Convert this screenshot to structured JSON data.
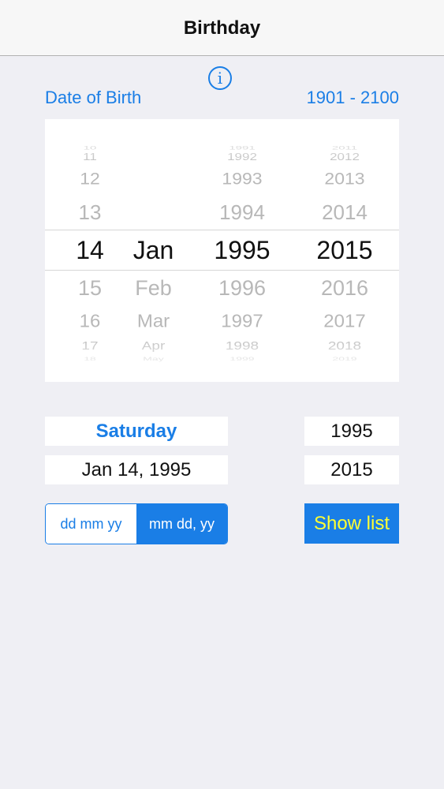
{
  "navbar": {
    "title": "Birthday"
  },
  "info": {
    "glyph": "i"
  },
  "header": {
    "dob_label": "Date of Birth",
    "range_label": "1901 - 2100"
  },
  "picker": {
    "days": [
      "10",
      "11",
      "12",
      "13",
      "14",
      "15",
      "16",
      "17",
      "18"
    ],
    "months": [
      "",
      "",
      "",
      "",
      "Jan",
      "Feb",
      "Mar",
      "Apr",
      "May"
    ],
    "years1": [
      "1991",
      "1992",
      "1993",
      "1994",
      "1995",
      "1996",
      "1997",
      "1998",
      "1999"
    ],
    "years2": [
      "2011",
      "2012",
      "2013",
      "2014",
      "2015",
      "2016",
      "2017",
      "2018",
      "2019"
    ],
    "selected_index": 4
  },
  "result": {
    "weekday": "Saturday",
    "full_date": "Jan 14,  1995",
    "year_a": "1995",
    "year_b": "2015"
  },
  "format": {
    "options": [
      "dd mm yy",
      "mm dd, yy"
    ],
    "selected_index": 1
  },
  "actions": {
    "show_list": "Show list"
  },
  "colors": {
    "accent": "#1a7ee6",
    "button_text": "#ffff33",
    "background": "#efeff4"
  }
}
